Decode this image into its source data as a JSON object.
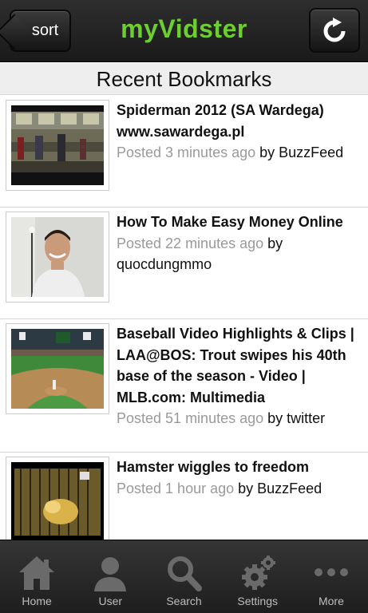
{
  "header": {
    "sort_label": "sort",
    "app_title": "myVidster",
    "title_color": "#6ccf2f"
  },
  "section": {
    "title": "Recent Bookmarks"
  },
  "bookmarks": [
    {
      "title": "Spiderman 2012 (SA Wardega) www.sawardega.pl",
      "posted": "Posted 3 minutes ago",
      "by": "by BuzzFeed",
      "thumb": "subway-car-scene"
    },
    {
      "title": "How To Make Easy Money Online",
      "posted": "Posted 22 minutes ago",
      "by": "by quocdungmmo",
      "thumb": "man-smiling-portrait"
    },
    {
      "title": "Baseball Video Highlights & Clips | LAA@BOS: Trout swipes his 40th base of the season - Video | MLB.com: Multimedia",
      "posted": "Posted 51 minutes ago",
      "by": "by twitter",
      "thumb": "baseball-stadium"
    },
    {
      "title": "Hamster wiggles to freedom",
      "posted": "Posted 1 hour ago",
      "by": "by BuzzFeed",
      "thumb": "hamster-cage"
    }
  ],
  "tabs": [
    {
      "label": "Home",
      "icon": "home-icon"
    },
    {
      "label": "User",
      "icon": "user-icon"
    },
    {
      "label": "Search",
      "icon": "search-icon"
    },
    {
      "label": "Settings",
      "icon": "settings-icon"
    },
    {
      "label": "More",
      "icon": "more-icon"
    }
  ]
}
